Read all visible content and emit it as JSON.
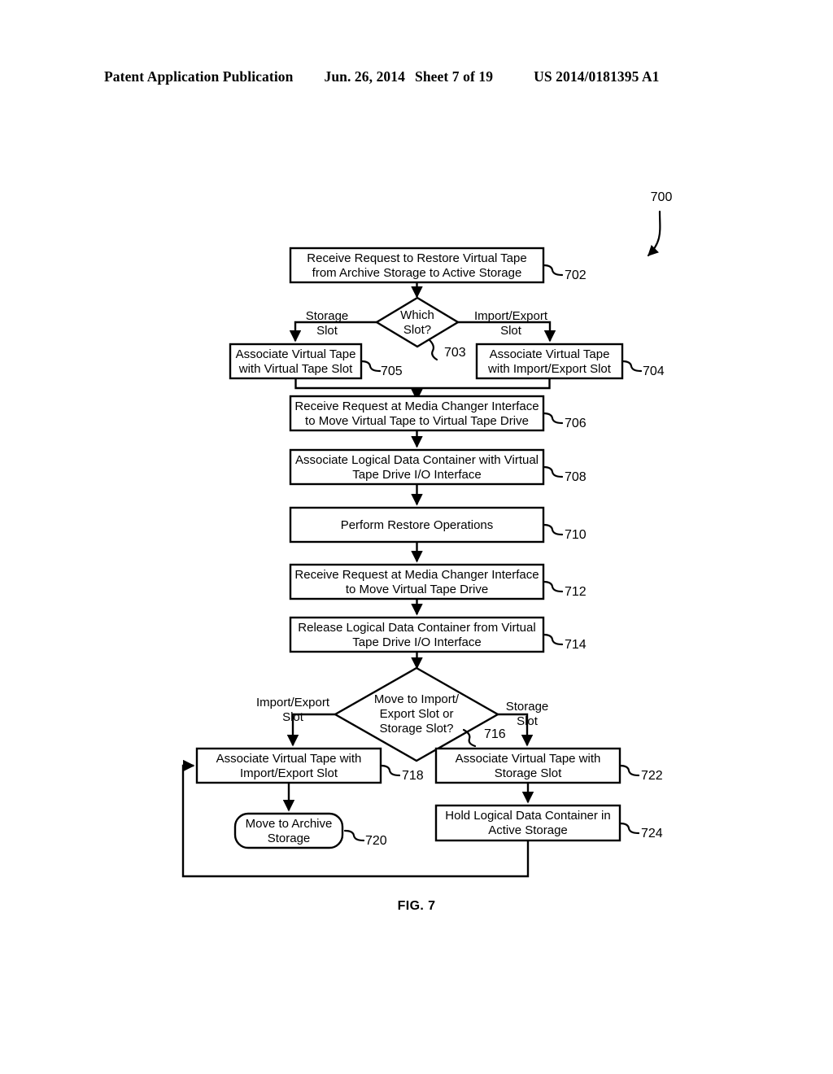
{
  "header": {
    "publication": "Patent Application Publication",
    "date": "Jun. 26, 2014",
    "sheet": "Sheet 7 of 19",
    "number": "US 2014/0181395 A1"
  },
  "figure": {
    "caption": "FIG. 7",
    "diagram_ref": "700"
  },
  "flowchart": {
    "type": "flowchart",
    "nodes": [
      {
        "id": "702",
        "ref": "702",
        "shape": "rect",
        "lines": [
          "Receive Request to Restore Virtual Tape",
          "from Archive Storage to Active Storage"
        ]
      },
      {
        "id": "703",
        "ref": "703",
        "shape": "diamond",
        "lines": [
          "Which",
          "Slot?"
        ]
      },
      {
        "id": "705",
        "ref": "705",
        "shape": "rect",
        "lines": [
          "Associate Virtual Tape",
          "with Virtual Tape Slot"
        ]
      },
      {
        "id": "704",
        "ref": "704",
        "shape": "rect",
        "lines": [
          "Associate Virtual Tape",
          "with Import/Export Slot"
        ]
      },
      {
        "id": "706",
        "ref": "706",
        "shape": "rect",
        "lines": [
          "Receive Request at Media Changer Interface",
          "to Move Virtual Tape to Virtual Tape Drive"
        ]
      },
      {
        "id": "708",
        "ref": "708",
        "shape": "rect",
        "lines": [
          "Associate Logical Data Container with Virtual",
          "Tape Drive I/O Interface"
        ]
      },
      {
        "id": "710",
        "ref": "710",
        "shape": "rect",
        "lines": [
          "Perform Restore Operations"
        ]
      },
      {
        "id": "712",
        "ref": "712",
        "shape": "rect",
        "lines": [
          "Receive Request at Media Changer Interface",
          "to Move Virtual Tape Drive"
        ]
      },
      {
        "id": "714",
        "ref": "714",
        "shape": "rect",
        "lines": [
          "Release Logical Data Container from Virtual",
          "Tape Drive I/O Interface"
        ]
      },
      {
        "id": "716",
        "ref": "716",
        "shape": "diamond",
        "lines": [
          "Move to Import/",
          "Export Slot or",
          "Storage Slot?"
        ]
      },
      {
        "id": "718",
        "ref": "718",
        "shape": "rect",
        "lines": [
          "Associate Virtual Tape with",
          "Import/Export Slot"
        ]
      },
      {
        "id": "722",
        "ref": "722",
        "shape": "rect",
        "lines": [
          "Associate Virtual Tape with",
          "Storage Slot"
        ]
      },
      {
        "id": "720",
        "ref": "720",
        "shape": "rounded-rect",
        "lines": [
          "Move to Archive",
          "Storage"
        ]
      },
      {
        "id": "724",
        "ref": "724",
        "shape": "rect",
        "lines": [
          "Hold Logical Data Container in",
          "Active Storage"
        ]
      }
    ],
    "edge_labels": [
      {
        "id": "storage-slot-left",
        "lines": [
          "Storage",
          "Slot"
        ]
      },
      {
        "id": "import-export-slot-right",
        "lines": [
          "Import/Export",
          "Slot"
        ]
      },
      {
        "id": "import-export-slot-left",
        "lines": [
          "Import/Export",
          "Slot"
        ]
      },
      {
        "id": "storage-slot-right",
        "lines": [
          "Storage",
          "Slot"
        ]
      }
    ]
  }
}
